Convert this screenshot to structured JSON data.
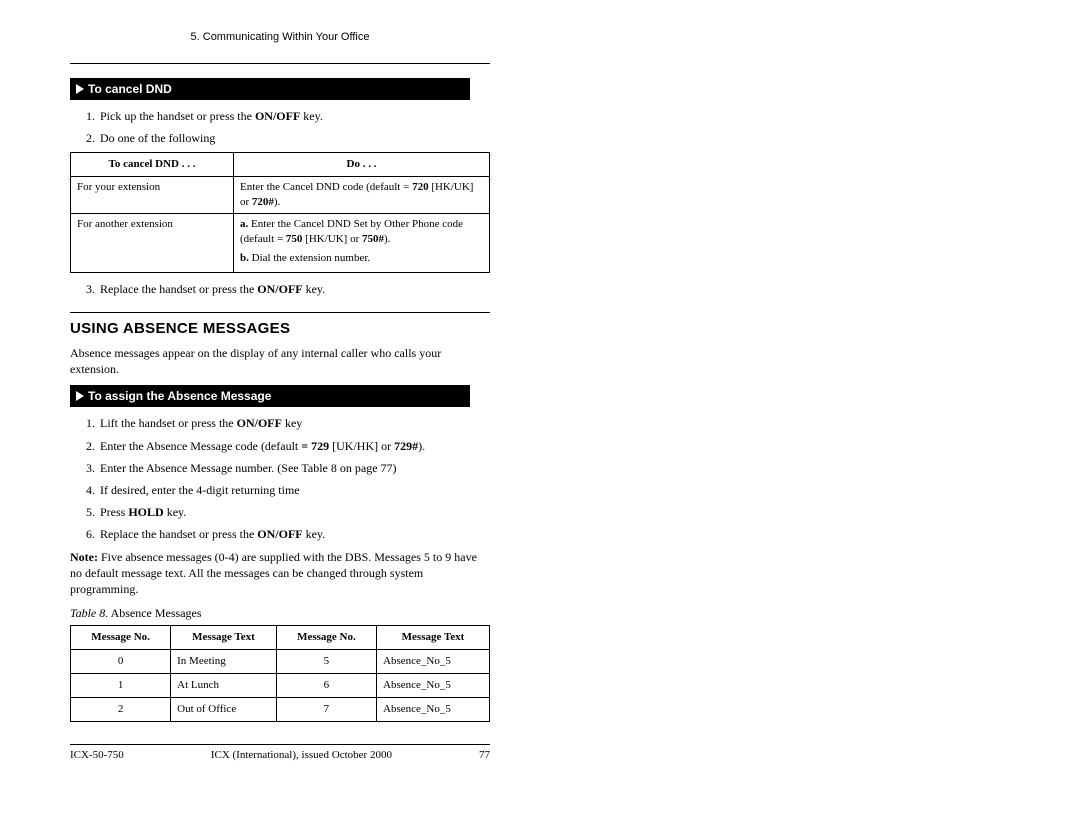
{
  "header": {
    "chapter": "5. Communicating Within Your Office"
  },
  "proc1": {
    "title": "To cancel DND",
    "step1_a": "Pick up the handset or press the ",
    "step1_b": "ON/OFF",
    "step1_c": " key.",
    "step2": "Do one of the following",
    "step3_a": "Replace the handset or press the ",
    "step3_b": "ON/OFF",
    "step3_c": " key."
  },
  "dnd_table": {
    "h1": "To cancel DND . . .",
    "h2": "Do . . .",
    "r1c1": "For your extension",
    "r1c2_a": "Enter the Cancel DND code (default = ",
    "r1c2_b": "720",
    "r1c2_c": " [HK/UK] or ",
    "r1c2_d": "720#",
    "r1c2_e": ").",
    "r2c1": "For another extension",
    "r2a_a": "a.",
    "r2a_b": " Enter the Cancel DND Set by Other Phone code (default = ",
    "r2a_c": "750",
    "r2a_d": " [HK/UK] or ",
    "r2a_e": "750#",
    "r2a_f": ").",
    "r2b_a": "b.",
    "r2b_b": " Dial the extension number."
  },
  "section2": {
    "title": "USING ABSENCE MESSAGES",
    "intro": "Absence messages appear on the display of any internal caller who calls your extension."
  },
  "proc2": {
    "title": "To assign the Absence Message",
    "s1_a": "Lift the handset or press the ",
    "s1_b": "ON/OFF",
    "s1_c": " key",
    "s2_a": "Enter the Absence Message code (default ",
    "s2_b": "= 729",
    "s2_c": " [UK/HK] or ",
    "s2_d": "729#",
    "s2_e": ").",
    "s3": "Enter the Absence Message number. (See Table 8 on page 77)",
    "s4": "If desired, enter the 4-digit returning time",
    "s5_a": "Press ",
    "s5_b": "HOLD",
    "s5_c": " key.",
    "s6_a": "Replace the handset or press the ",
    "s6_b": "ON/OFF",
    "s6_c": " key."
  },
  "note": {
    "label": "Note: ",
    "text": " Five absence messages (0-4) are supplied with the DBS.  Messages 5 to 9 have no default message text. All the messages can be changed through system programming."
  },
  "caption": {
    "lead": "Table 8.",
    "text": "  Absence Messages"
  },
  "msgs_table": {
    "h1": "Message No.",
    "h2": "Message Text",
    "h3": "Message No.",
    "h4": "Message Text",
    "rows": [
      {
        "a": "0",
        "b": "In Meeting",
        "c": "5",
        "d": "Absence_No_5"
      },
      {
        "a": "1",
        "b": "At Lunch",
        "c": "6",
        "d": "Absence_No_5"
      },
      {
        "a": "2",
        "b": "Out of Office",
        "c": "7",
        "d": "Absence_No_5"
      }
    ]
  },
  "footer": {
    "left": "ICX-50-750",
    "center": "ICX (International), issued October 2000",
    "right": "77"
  }
}
